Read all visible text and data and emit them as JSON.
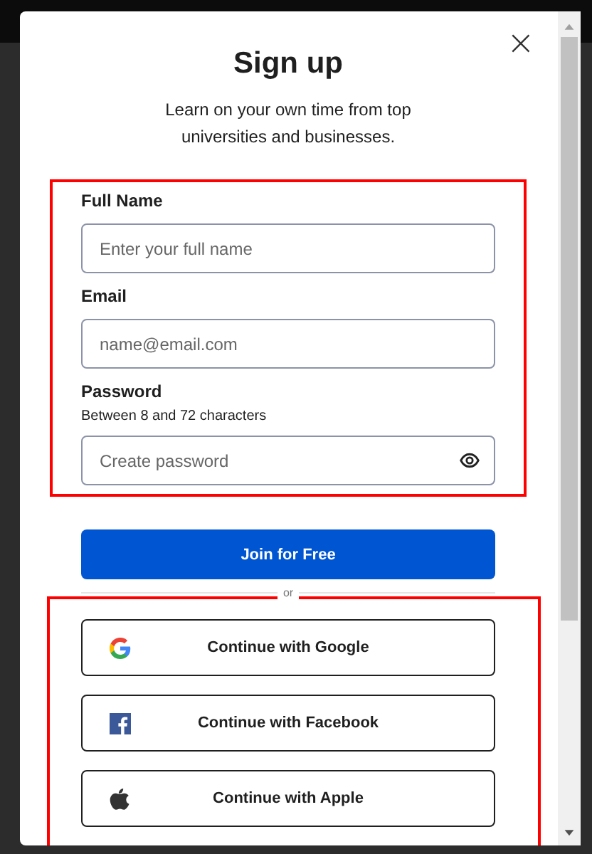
{
  "dialog": {
    "title": "Sign up",
    "subtitle": "Learn on your own time from top universities and businesses.",
    "close_glyph": "×"
  },
  "form": {
    "outlined": true,
    "fields": [
      {
        "kind": "text",
        "label": "Full Name",
        "placeholder": "Enter your full name"
      },
      {
        "kind": "text",
        "label": "Email",
        "placeholder": "name@email.com"
      },
      {
        "kind": "password",
        "label": "Password",
        "hint": "Between 8 and 72 characters",
        "placeholder": "Create password"
      }
    ]
  },
  "submit_button": "Join for Free",
  "divider": "or",
  "social": {
    "outlined": true,
    "buttons": [
      {
        "kind": "google",
        "label": "Continue with Google"
      },
      {
        "kind": "facebook",
        "label": "Continue with Facebook"
      },
      {
        "kind": "apple",
        "label": "Continue with Apple"
      }
    ]
  }
}
